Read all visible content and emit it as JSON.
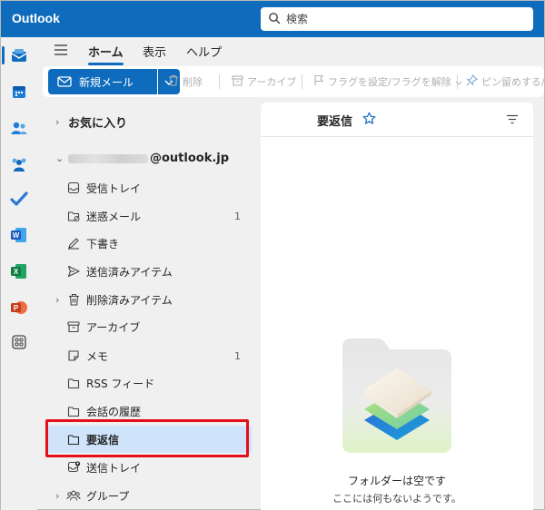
{
  "app": {
    "title": "Outlook"
  },
  "search": {
    "placeholder": "検索"
  },
  "ribbon": {
    "tabs": [
      {
        "label": "ホーム",
        "active": true
      },
      {
        "label": "表示",
        "active": false
      },
      {
        "label": "ヘルプ",
        "active": false
      }
    ]
  },
  "toolbar": {
    "new_mail": "新規メール",
    "delete": "削除",
    "archive": "アーカイブ",
    "flag": "フラグを設定/フラグを解除",
    "pin": "ピン留めする/ピ"
  },
  "folders": {
    "favorites": "お気に入り",
    "account_suffix": "@outlook.jp",
    "items": [
      {
        "label": "受信トレイ",
        "icon": "inbox-icon",
        "count": ""
      },
      {
        "label": "迷惑メール",
        "icon": "junk-icon",
        "count": "1"
      },
      {
        "label": "下書き",
        "icon": "draft-icon",
        "count": ""
      },
      {
        "label": "送信済みアイテム",
        "icon": "send-icon",
        "count": ""
      },
      {
        "label": "削除済みアイテム",
        "icon": "trash-icon",
        "count": ""
      },
      {
        "label": "アーカイブ",
        "icon": "archive-icon",
        "count": ""
      },
      {
        "label": "メモ",
        "icon": "note-icon",
        "count": "1"
      },
      {
        "label": "RSS フィード",
        "icon": "folder-icon",
        "count": ""
      },
      {
        "label": "会話の履歴",
        "icon": "folder-icon",
        "count": ""
      },
      {
        "label": "要返信",
        "icon": "folder-icon",
        "count": ""
      },
      {
        "label": "送信トレイ",
        "icon": "outbox-icon",
        "count": ""
      },
      {
        "label": "グループ",
        "icon": "group-icon",
        "count": ""
      }
    ]
  },
  "message_list": {
    "title": "要返信",
    "empty_title": "フォルダーは空です",
    "empty_subtitle": "ここには何もないようです。"
  },
  "colors": {
    "accent": "#0f6cbd",
    "selected": "#cfe4fa",
    "highlight": "#e3101a"
  }
}
